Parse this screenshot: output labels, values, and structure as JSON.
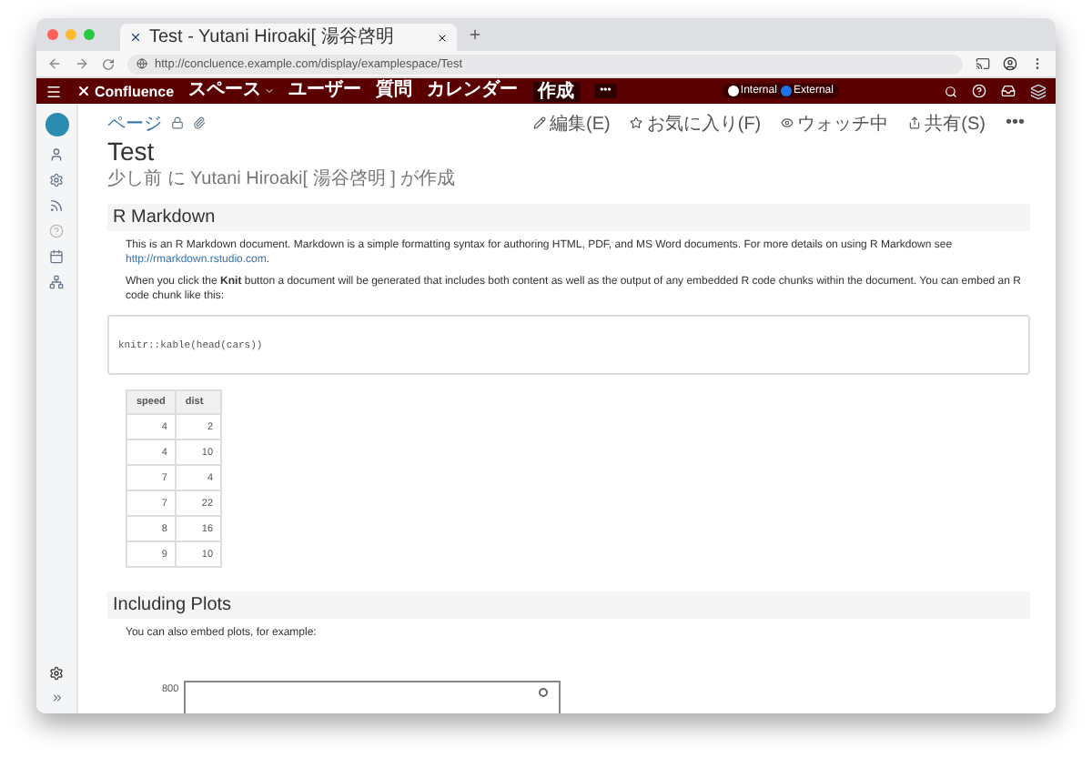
{
  "browser": {
    "tab_title": "Test - Yutani Hiroaki[ 湯谷啓明",
    "url": "http://concluence.example.com/display/examplespace/Test"
  },
  "nav": {
    "logo": "Confluence",
    "items": [
      {
        "label": "スペース",
        "dropdown": true
      },
      {
        "label": "ユーザー",
        "dropdown": false
      },
      {
        "label": "質問",
        "dropdown": false
      },
      {
        "label": "カレンダー",
        "dropdown": false
      }
    ],
    "create": "作成",
    "more": "•••",
    "toggle": [
      {
        "label": "Internal",
        "selected": false
      },
      {
        "label": "External",
        "selected": true
      }
    ]
  },
  "page_toolbar": {
    "breadcrumb": "ページ",
    "actions": [
      {
        "kind": "edit",
        "label": "編集(E)"
      },
      {
        "kind": "star",
        "label": "お気に入り(F)"
      },
      {
        "kind": "watch",
        "label": "ウォッチ中"
      },
      {
        "kind": "share",
        "label": "共有(S)"
      }
    ],
    "more": "•••"
  },
  "page": {
    "title": "Test",
    "meta": "少し前 に Yutani Hiroaki[ 湯谷啓明 ] が作成",
    "sections": [
      {
        "heading": "R Markdown",
        "paragraphs": [
          "This is an R Markdown document. Markdown is a simple formatting syntax for authoring HTML, PDF, and MS Word documents. For more details on using R Markdown see",
          "When you click the **Knit** button a document will be generated that includes both content as well as the output of any embedded R code chunks within the document. You can embed an R code chunk like this:"
        ],
        "link": "http://rmarkdown.rstudio.com",
        "link_trailer": ".",
        "code": "knitr::kable(head(cars))",
        "table": {
          "columns": [
            "speed",
            "dist"
          ],
          "rows": [
            [
              "4",
              "2"
            ],
            [
              "4",
              "10"
            ],
            [
              "7",
              "4"
            ],
            [
              "7",
              "22"
            ],
            [
              "8",
              "16"
            ],
            [
              "9",
              "10"
            ]
          ]
        }
      },
      {
        "heading": "Including Plots",
        "paragraphs": [
          "You can also embed plots, for example:"
        ],
        "plot": {
          "y_tick_labels": [
            "800"
          ]
        }
      }
    ]
  }
}
